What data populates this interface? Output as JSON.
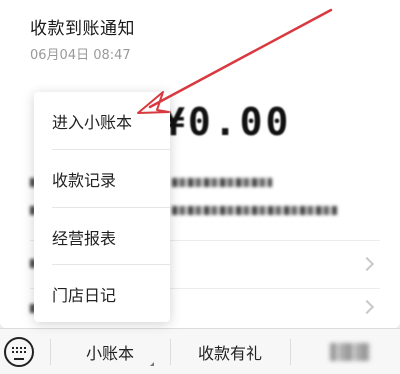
{
  "notice": {
    "title": "收款到账通知",
    "time": "06月04日 08:47",
    "amount": "¥0.00"
  },
  "popup_menu": {
    "items": [
      "进入小账本",
      "收款记录",
      "经营报表",
      "门店日记"
    ]
  },
  "bottom_bar": {
    "keyboard_icon": "keyboard-icon",
    "tabs": [
      "小账本",
      "收款有礼"
    ]
  },
  "annotation": {
    "color": "#d9383f"
  }
}
